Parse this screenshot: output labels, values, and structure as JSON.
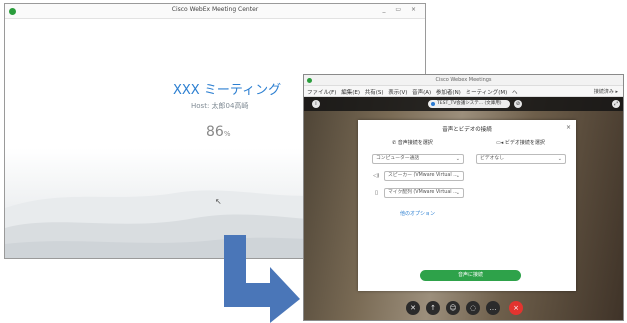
{
  "meeting_center": {
    "window_title": "Cisco WebEx Meeting Center",
    "window_controls": "_ ▭ ×",
    "meeting_title": "XXX ミーティング",
    "host": "Host: 太郎04高崎",
    "progress_value": "86",
    "progress_unit": "%"
  },
  "webex": {
    "window_title": "Cisco Webex Meetings",
    "menu": [
      "ファイル(F)",
      "編集(E)",
      "共有(S)",
      "表示(V)",
      "音声(A)",
      "参加者(N)",
      "ミーティング(M)",
      "ヘ"
    ],
    "menu_right": "接続済み ▸",
    "meeting_pill": "TEST_TV会議システ... (文庫用)",
    "dialog": {
      "title": "音声とビデオの接続",
      "audio_header": "音声接続を選択",
      "video_header": "ビデオ接続を選択",
      "audio_select": "コンピューター通話",
      "video_select": "ビデオなし",
      "speaker_select": "スピーカー (VMware Virtual ...",
      "mic_select": "マイク配列 (VMware Virtual ...",
      "more_options": "他のオプション",
      "connect_button": "音声に接続"
    }
  },
  "colors": {
    "accent_blue": "#2c7fd1",
    "arrow_blue": "#4a76b8",
    "connect_green": "#2ea24a",
    "end_red": "#e3342f"
  }
}
